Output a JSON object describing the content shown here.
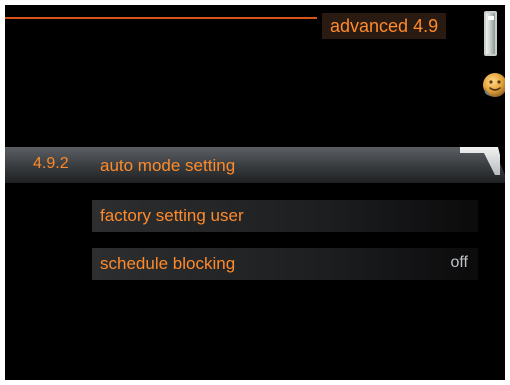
{
  "header": {
    "title": "advanced  4.9"
  },
  "icons": {
    "tank": "water-tank-icon",
    "comfort": "smiley-face-icon"
  },
  "menu": {
    "items": [
      {
        "id": "4.9.2",
        "label": "auto mode setting",
        "selected": true
      },
      {
        "label": "factory setting user"
      },
      {
        "label": "schedule blocking",
        "value": "off"
      }
    ]
  },
  "colors": {
    "accent": "#ff8a2a",
    "header_line": "#d9541a",
    "background": "#000000",
    "value_text": "#bfc3c6"
  }
}
